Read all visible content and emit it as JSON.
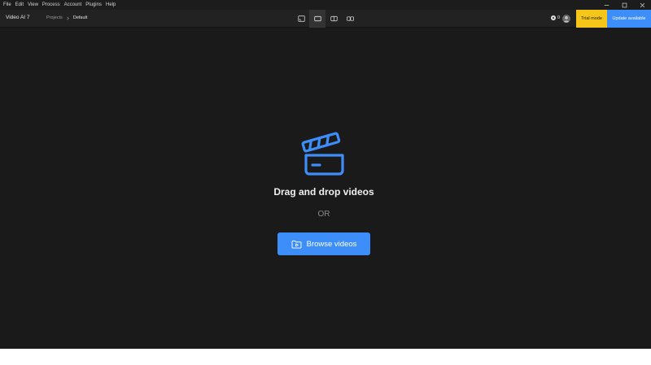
{
  "menu": {
    "items": [
      "File",
      "Edit",
      "View",
      "Process",
      "Account",
      "Plugins",
      "Help"
    ]
  },
  "window_controls": [
    "minimize-icon",
    "maximize-icon",
    "close-icon"
  ],
  "header": {
    "app_title": "Video AI 7",
    "breadcrumb": [
      "Projects",
      "Default"
    ],
    "view_modes": [
      "single-view-icon",
      "full-view-icon",
      "split-view-icon",
      "side-by-side-view-icon"
    ],
    "active_view_index": 1,
    "credits": "0",
    "trial_label": "Trial mode",
    "update_label": "Update available"
  },
  "dropzone": {
    "icon": "clapperboard-icon",
    "title": "Drag and drop videos",
    "or_label": "OR",
    "browse_label": "Browse videos"
  },
  "colors": {
    "background": "#1a1a1a",
    "header": "#222222",
    "accent": "#3d8ef8",
    "trial": "#f5c518"
  }
}
